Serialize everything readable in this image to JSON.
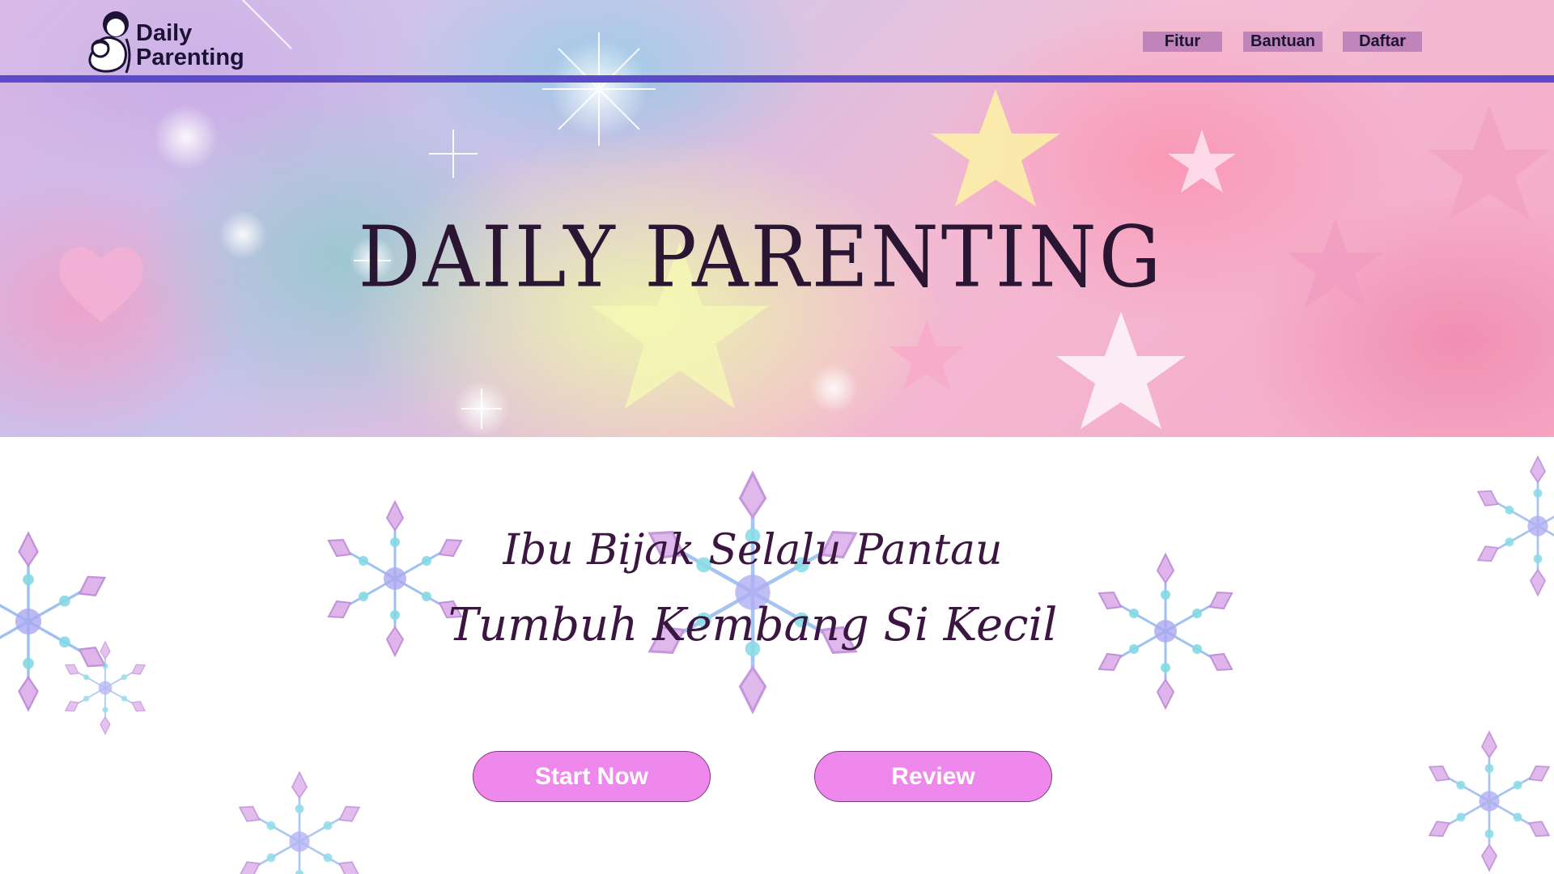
{
  "brand": {
    "logo_line1": "Daily",
    "logo_line2": "Parenting"
  },
  "nav": {
    "items": [
      {
        "label": "Fitur"
      },
      {
        "label": "Bantuan"
      },
      {
        "label": "Daftar"
      }
    ]
  },
  "hero": {
    "title": "DAILY PARENTING"
  },
  "tagline": {
    "line1": "Ibu Bijak Selalu Pantau",
    "line2": "Tumbuh Kembang Si Kecil"
  },
  "actions": {
    "start_label": "Start Now",
    "review_label": "Review"
  },
  "colors": {
    "accent": "#5b4bc9",
    "button": "#ef88ec",
    "title_text": "#2a1533"
  }
}
